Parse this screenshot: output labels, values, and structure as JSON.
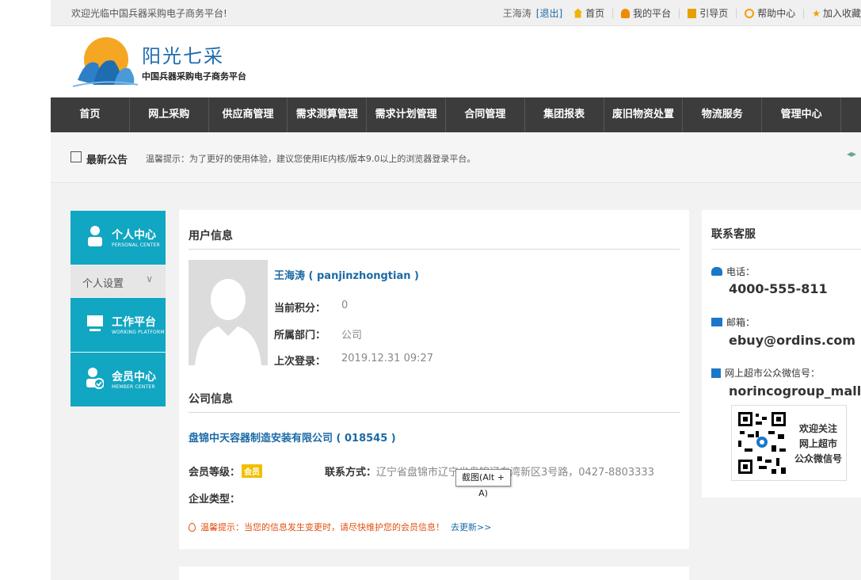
{
  "topbar": {
    "welcome": "欢迎光临中国兵器采购电子商务平台!",
    "user": "王海涛",
    "logout": "[退出]",
    "links": [
      "首页",
      "我的平台",
      "引导页",
      "帮助中心",
      "加入收藏"
    ]
  },
  "header": {
    "logo_title": "阳光七采",
    "logo_subtitle": "中国兵器采购电子商务平台"
  },
  "nav": [
    "首页",
    "网上采购",
    "供应商管理",
    "需求测算管理",
    "需求计划管理",
    "合同管理",
    "集团报表",
    "废旧物资处置",
    "物流服务",
    "管理中心"
  ],
  "notice": {
    "title": "最新公告",
    "text": "温馨提示：为了更好的使用体验，建议您使用IE内核/版本9.0以上的浏览器登录平台。"
  },
  "sidebar": {
    "personal": {
      "title": "个人中心",
      "subtitle": "PERSONAL CENTER"
    },
    "settings": "个人设置",
    "working": {
      "title": "工作平台",
      "subtitle": "WORKING PLATFORM"
    },
    "member": {
      "title": "会员中心",
      "subtitle": "MEMBER CENTER"
    }
  },
  "user_info": {
    "section_title": "用户信息",
    "name": "王海涛 ( panjinzhongtian )",
    "points_label": "当前积分：",
    "points": "0",
    "dept_label": "所属部门：",
    "dept": "公司",
    "last_login_label": "上次登录：",
    "last_login": "2019.12.31 09:27"
  },
  "company_info": {
    "section_title": "公司信息",
    "name": "盘锦中天容器制造安装有限公司 ( 018545 )",
    "level_label": "会员等级：",
    "level_badge": "会员",
    "contact_label": "联系方式：",
    "contact": "辽宁省盘锦市辽宁省盘锦辽东湾新区3号路，0427-8803333",
    "type_label": "企业类型：",
    "tip_label": "温馨提示：",
    "tip_text": "当您的信息发生变更时，请尽快维护您的会员信息！",
    "tip_link": "去更新>>"
  },
  "tooltip": "截图(Alt + A)",
  "contact_service": {
    "title": "联系客服",
    "phone_label": "电话：",
    "phone": "4000-555-811",
    "email_label": "邮箱：",
    "email": "ebuy@ordins.com",
    "wechat_label": "网上超市公众微信号：",
    "wechat": "norincogroup_mall",
    "qr_lines": [
      "欢迎关注",
      "网上超市",
      "公众微信号"
    ]
  },
  "colors": {
    "accent": "#11a6c2",
    "nav_bg": "#3c3c3c",
    "link": "#1b6aa5"
  }
}
